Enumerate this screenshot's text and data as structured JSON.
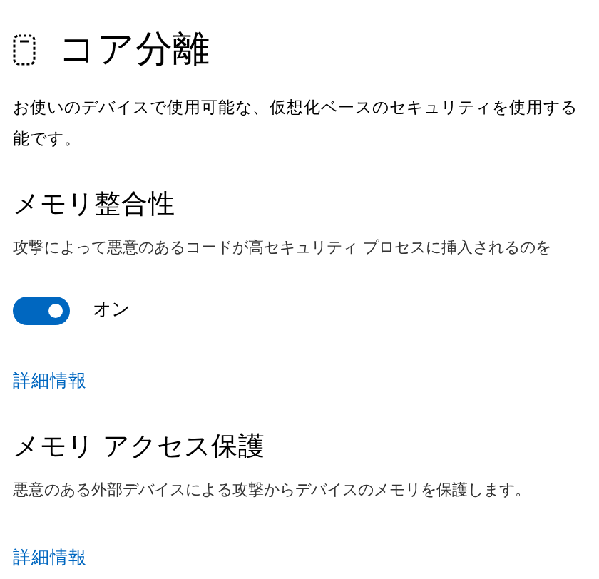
{
  "page": {
    "title": "コア分離",
    "description_lines": [
      "お使いのデバイスで使用可能な、仮想化ベースのセキュリティを使用する",
      "能です。"
    ]
  },
  "sections": [
    {
      "heading": "メモリ整合性",
      "description": "攻撃によって悪意のあるコードが高セキュリティ プロセスに挿入されるのを",
      "toggle": {
        "on": true,
        "label": "オン"
      },
      "link": "詳細情報"
    },
    {
      "heading": "メモリ アクセス保護",
      "description": "悪意のある外部デバイスによる攻撃からデバイスのメモリを保護します。",
      "link": "詳細情報"
    }
  ]
}
